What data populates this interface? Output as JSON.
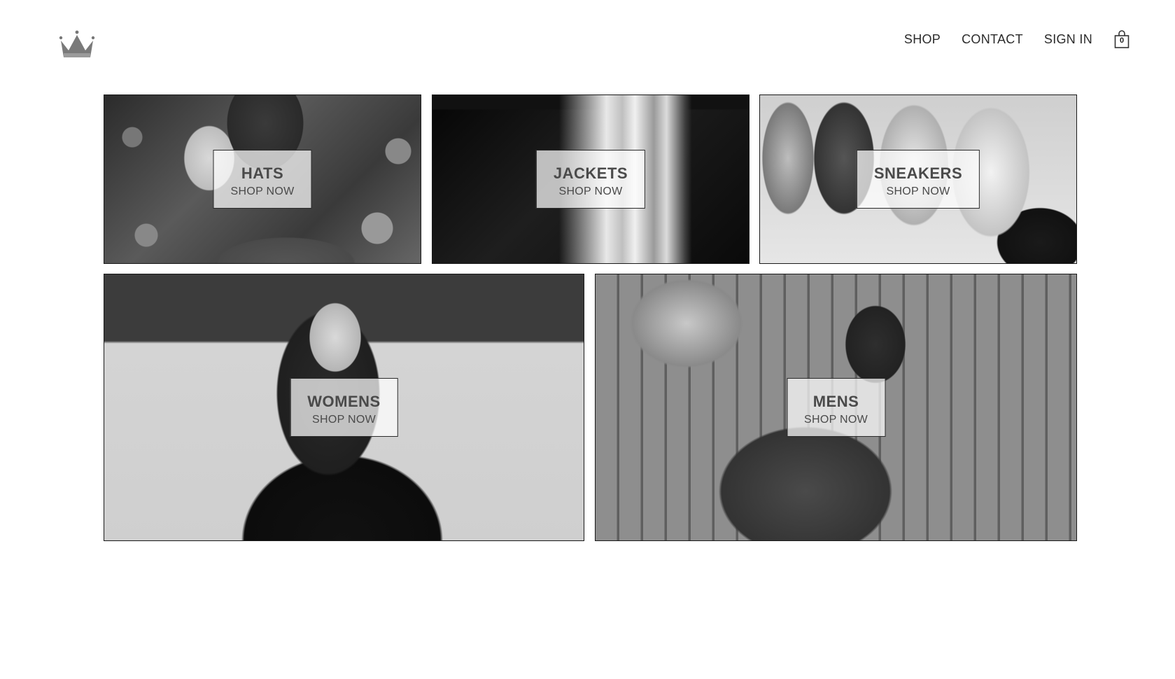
{
  "header": {
    "logo_icon": "crown-icon",
    "nav": [
      {
        "label": "SHOP"
      },
      {
        "label": "CONTACT"
      },
      {
        "label": "SIGN IN"
      }
    ],
    "cart": {
      "icon": "shopping-bag-icon",
      "count": "0"
    }
  },
  "directory": {
    "tiles": [
      {
        "title": "HATS",
        "subtitle": "SHOP NOW"
      },
      {
        "title": "JACKETS",
        "subtitle": "SHOP NOW"
      },
      {
        "title": "SNEAKERS",
        "subtitle": "SHOP NOW"
      },
      {
        "title": "WOMENS",
        "subtitle": "SHOP NOW"
      },
      {
        "title": "MENS",
        "subtitle": "SHOP NOW"
      }
    ]
  },
  "colors": {
    "text": "#2b2b2b",
    "label_bg": "#ffffffb8",
    "border": "#1a1a1a"
  }
}
